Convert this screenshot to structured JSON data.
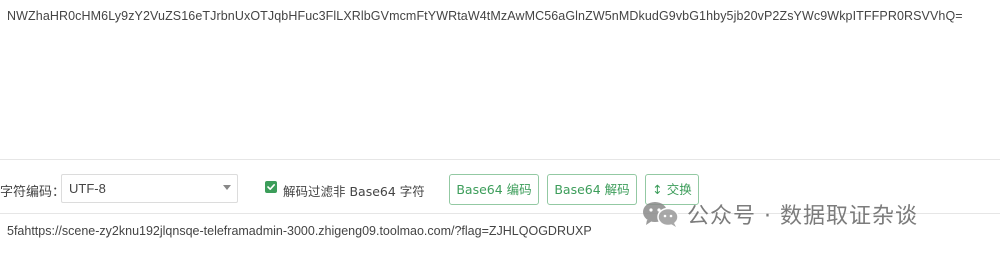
{
  "input": {
    "value": "NWZhaHR0cHM6Ly9zY2VuZS16eTJrbnUxOTJqbHFuc3FlLXRlbGVmcmFtYWRtaW4tMzAwMC56aGlnZW5nMDkudG9vbG1hby5jb20vP2ZsYWc9WkpITFFPR0RSVVhQ="
  },
  "toolbar": {
    "charset_label": "字符编码：",
    "charset_value": "UTF-8",
    "filter_label": "解码过滤非 Base64 字符",
    "filter_checked": true,
    "encode_label": "Base64 编码",
    "decode_label": "Base64 解码",
    "swap_label": "↕ 交换"
  },
  "output": {
    "value": "5fahttps://scene-zy2knu192jlqnsqe-teleframadmin-3000.zhigeng09.toolmao.com/?flag=ZJHLQOGDRUXP"
  },
  "watermark": {
    "icon": "wechat-icon",
    "text": "公众号 · 数据取证杂谈"
  },
  "colors": {
    "accent": "#3c9d5a",
    "button_border": "#93c9a3",
    "divider": "#e6e6e6"
  }
}
